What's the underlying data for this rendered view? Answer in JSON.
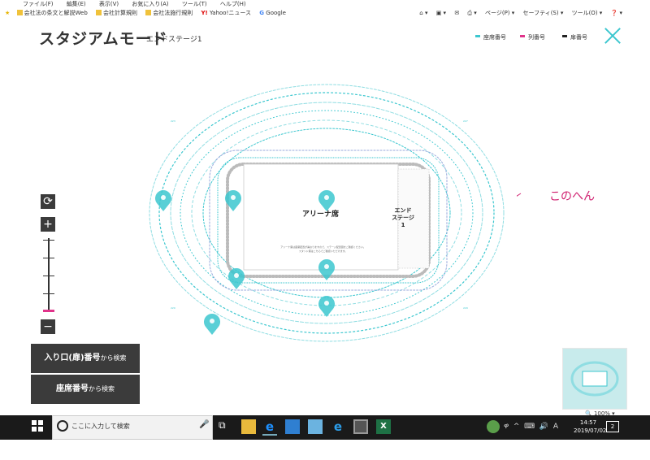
{
  "ie": {
    "menu": [
      "ファイル(F)",
      "編集(E)",
      "表示(V)",
      "お気に入り(A)",
      "ツール(T)",
      "ヘルプ(H)"
    ],
    "favorites": [
      "会社法の条文と解説Web",
      "会社計算規則",
      "会社法施行規則",
      "Yahoo!ニュース",
      "Google"
    ],
    "tools": [
      "ページ(P) ▾",
      "セーフティ(S) ▾",
      "ツール(O) ▾",
      "❓ ▾"
    ]
  },
  "header": {
    "title": "スタジアムモード",
    "subtitle": "エンドステージ1",
    "legend": [
      {
        "label": "座席番号",
        "color": "#3cc7cf"
      },
      {
        "label": "列番号",
        "color": "#e0338a"
      },
      {
        "label": "扉番号",
        "color": "#222222"
      }
    ]
  },
  "controls": {
    "reset": "⟳",
    "zoom_in": "+",
    "zoom_out": "−"
  },
  "buttons": {
    "entrance_main": "入り口(扉)番号",
    "entrance_suffix": "から検索",
    "seat_main": "座席番号",
    "seat_suffix": "から検索"
  },
  "map": {
    "arena_label": "アリーナ席",
    "stage_label_1": "エンド",
    "stage_label_2": "ステージ",
    "stage_label_3": "1",
    "notice_line1": "アリーナ席は座席配置が異なりますので、ステージ配置図をご確認ください。",
    "notice_line2": "スタンド席はこちらでご確認いただけます。"
  },
  "annotation": {
    "text": "このへん",
    "color": "#d02070"
  },
  "zoom_level": "🔍 100% ▾",
  "colors": {
    "accent": "#3cc7cf",
    "pink": "#e0338a",
    "button_bg": "#3b3b3b"
  },
  "taskbar": {
    "search_placeholder": "ここに入力して検索",
    "time": "14:57",
    "date": "2019/07/02",
    "notifications": "2"
  }
}
